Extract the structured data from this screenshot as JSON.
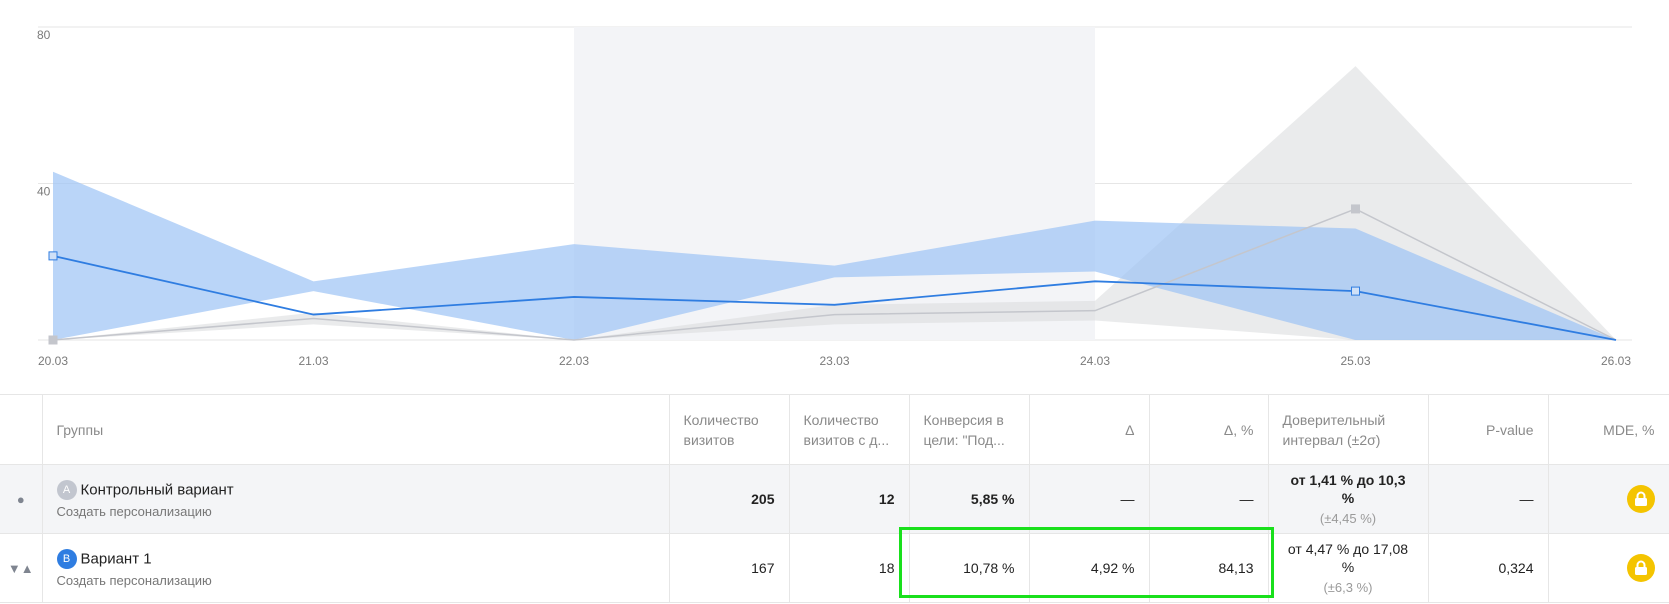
{
  "chart_data": {
    "type": "line",
    "x": [
      "20.03",
      "21.03",
      "22.03",
      "23.03",
      "24.03",
      "25.03",
      "26.03"
    ],
    "ylim": [
      0,
      80
    ],
    "yticks": [
      40,
      80
    ],
    "highlight_range": [
      "22.03",
      "24.03"
    ],
    "grid": true,
    "series": [
      {
        "name": "",
        "color": "#2f7de1",
        "values": [
          21.5,
          6.5,
          11,
          9,
          15,
          12.5,
          0
        ],
        "upper": [
          43,
          15,
          24.5,
          19,
          30.5,
          28.5,
          0
        ],
        "lower": [
          0,
          12.5,
          0,
          16,
          17.5,
          0,
          0
        ]
      },
      {
        "name": "",
        "color": "#c4c6cc",
        "values": [
          0,
          5.5,
          0,
          6.5,
          7.5,
          33.5,
          0
        ],
        "upper": [
          0,
          7,
          0,
          9,
          10,
          70,
          0
        ],
        "lower": [
          0,
          4,
          0,
          4,
          5,
          0,
          0
        ]
      }
    ]
  },
  "table": {
    "headers": {
      "groups": "Группы",
      "visits_1": "Количество",
      "visits_2": "визитов",
      "goal_visits_1": "Количество",
      "goal_visits_2": "визитов с д...",
      "conv_1": "Конверсия в",
      "conv_2": "цели: \"Под...",
      "delta": "Δ",
      "delta_pct": "Δ, %",
      "ci_1": "Доверительный",
      "ci_2": "интервал (±2σ)",
      "pvalue": "P-value",
      "mde": "MDE, %"
    },
    "rows": [
      {
        "marker": "●",
        "badge": "A",
        "name": "Контрольный вариант",
        "link": "Создать персонализацию",
        "visits": "205",
        "goal_visits": "12",
        "conversion": "5,85 %",
        "delta": "—",
        "delta_pct": "—",
        "ci": "от 1,41 % до 10,3 %",
        "ci_sub": "(±4,45 %)",
        "pvalue": "—"
      },
      {
        "marker": "▼▲",
        "badge": "B",
        "name": "Вариант 1",
        "link": "Создать персонализацию",
        "visits": "167",
        "goal_visits": "18",
        "conversion": "10,78 %",
        "delta": "4,92 %",
        "delta_pct": "84,13",
        "ci": "от 4,47 % до 17,08 %",
        "ci_sub": "(±6,3 %)",
        "pvalue": "0,324"
      }
    ],
    "lock_icon": "lock-icon",
    "lock_color": "#f4c400",
    "highlight_color": "#19e01c"
  }
}
